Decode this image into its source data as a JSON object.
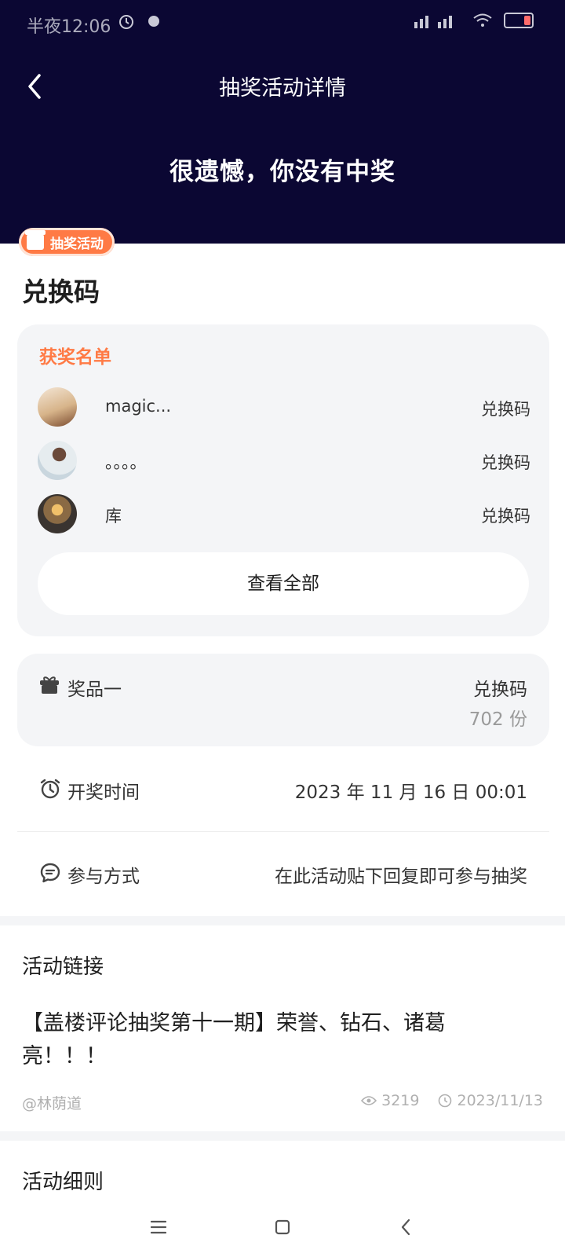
{
  "status_bar": {
    "time": "半夜12:06"
  },
  "header": {
    "title": "抽奖活动详情",
    "result_text": "很遗憾，你没有中奖"
  },
  "activity_tag": "抽奖活动",
  "prize_name_title": "兑换码",
  "winners": {
    "heading": "获奖名单",
    "items": [
      {
        "name": "magic...",
        "prize": "兑换码"
      },
      {
        "name": "。。。。",
        "prize": "兑换码"
      },
      {
        "name": "库",
        "prize": "兑换码"
      }
    ],
    "view_all_label": "查看全部"
  },
  "prize_card": {
    "label": "奖品一",
    "name": "兑换码",
    "count": "702 份"
  },
  "draw_time": {
    "label": "开奖时间",
    "value": "2023 年 11 月 16 日 00:01"
  },
  "participation": {
    "label": "参与方式",
    "value": "在此活动贴下回复即可参与抽奖"
  },
  "activity_link": {
    "heading": "活动链接",
    "post_title": "【盖楼评论抽奖第十一期】荣誉、钻石、诸葛亮！！！",
    "author": "@林荫道",
    "views": "3219",
    "date": "2023/11/13"
  },
  "rules_heading": "活动细则",
  "colors": {
    "header_bg": "#0b0733",
    "accent": "#ff7a45",
    "card_bg": "#f4f5f7"
  },
  "icons": [
    "back-arrow-icon",
    "gift-icon",
    "alarm-clock-icon",
    "chat-bubble-icon",
    "eye-icon",
    "clock-icon",
    "menu-icon",
    "home-icon",
    "back-icon"
  ]
}
